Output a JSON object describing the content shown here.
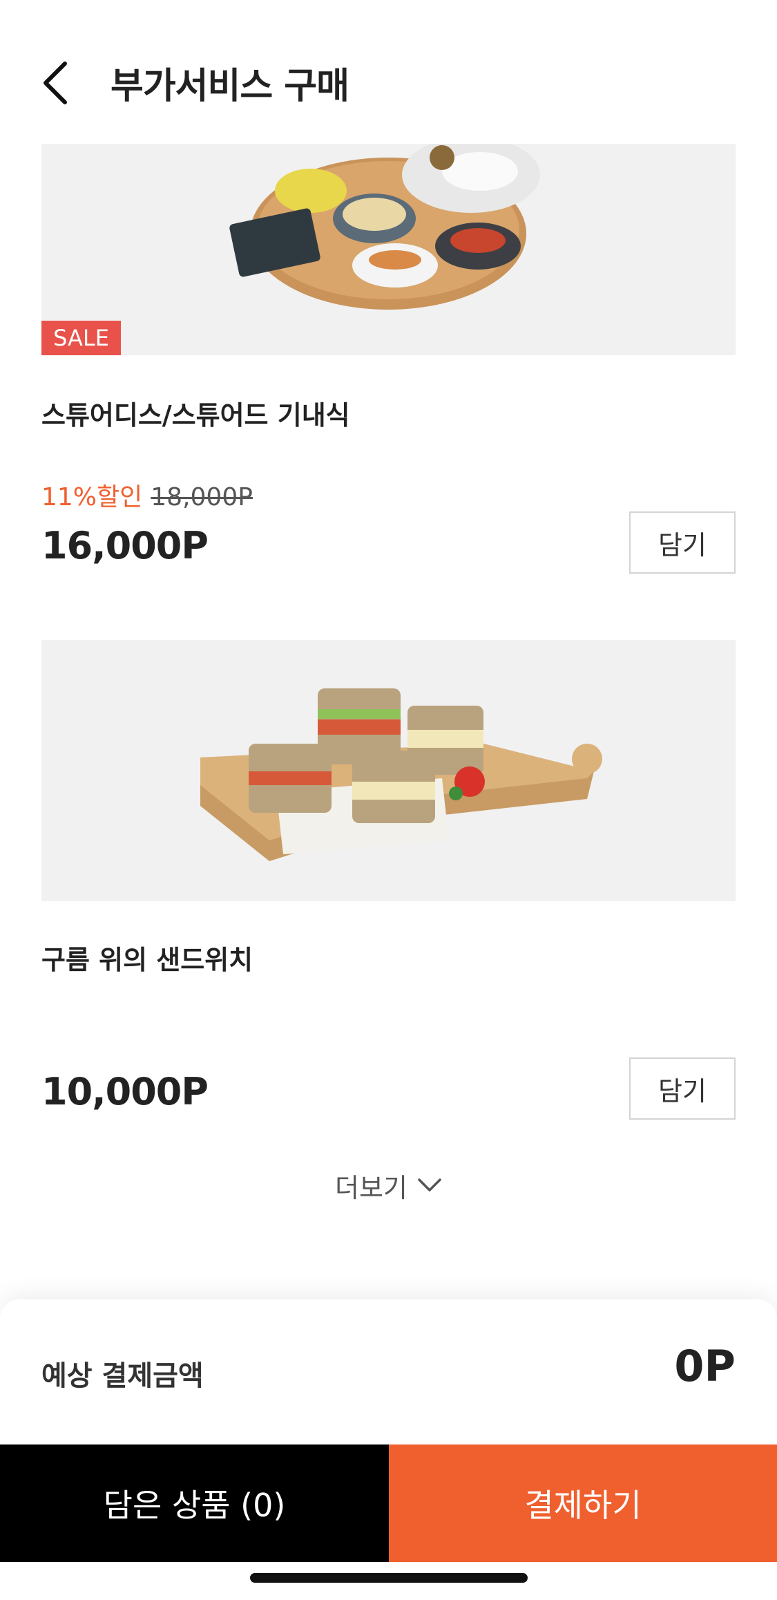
{
  "header": {
    "title": "부가서비스 구매",
    "back_icon": "chevron-left-icon"
  },
  "products": [
    {
      "image_alt": "스튜어디스/스튜어드 기내식",
      "badge": "SALE",
      "name": "스튜어디스/스튜어드 기내식",
      "discount_rate": "11%할인",
      "original_price": "18,000P",
      "price": "16,000P",
      "add_label": "담기"
    },
    {
      "image_alt": "구름 위의 샌드위치",
      "name": "구름 위의 샌드위치",
      "price": "10,000P",
      "add_label": "담기"
    }
  ],
  "more": {
    "label": "더보기",
    "icon": "chevron-down-icon"
  },
  "summary": {
    "estimate_label": "예상 결제금액",
    "estimate_value": "0P"
  },
  "actions": {
    "cart_label": "담은 상품 (0)",
    "pay_label": "결제하기"
  },
  "colors": {
    "accent": "#f0602f",
    "sale": "#e8524a",
    "dark": "#000000"
  }
}
